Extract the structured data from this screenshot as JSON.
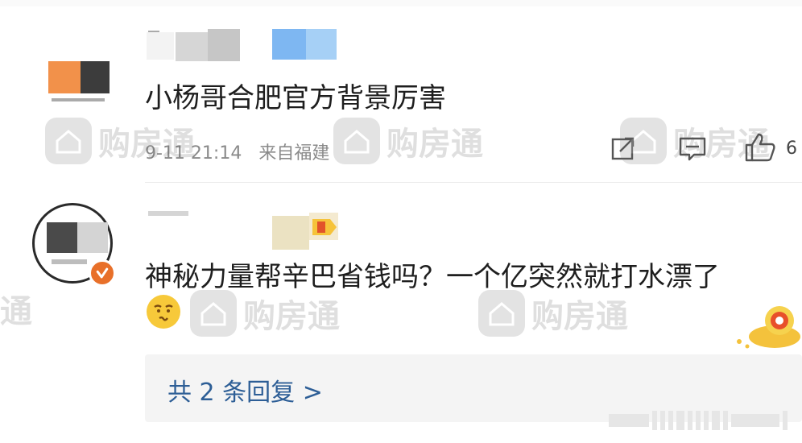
{
  "comments": [
    {
      "text": "小杨哥合肥官方背景厉害",
      "time": "9-11 21:14",
      "source": "来自福建",
      "like_count": "6",
      "actions": [
        "share-icon",
        "comment-icon",
        "like-icon"
      ]
    },
    {
      "text": "神秘力量帮辛巴省钱吗？一个亿突然就打水漂了",
      "emoji": "grimace-emoji",
      "reply_summary": "共 2 条回复 >"
    }
  ],
  "watermark": {
    "text": "购房通",
    "logo_sub": "购房通"
  },
  "colors": {
    "link": "#2d5e96",
    "verified": "#e8702a",
    "meta": "#8a8a8a"
  }
}
